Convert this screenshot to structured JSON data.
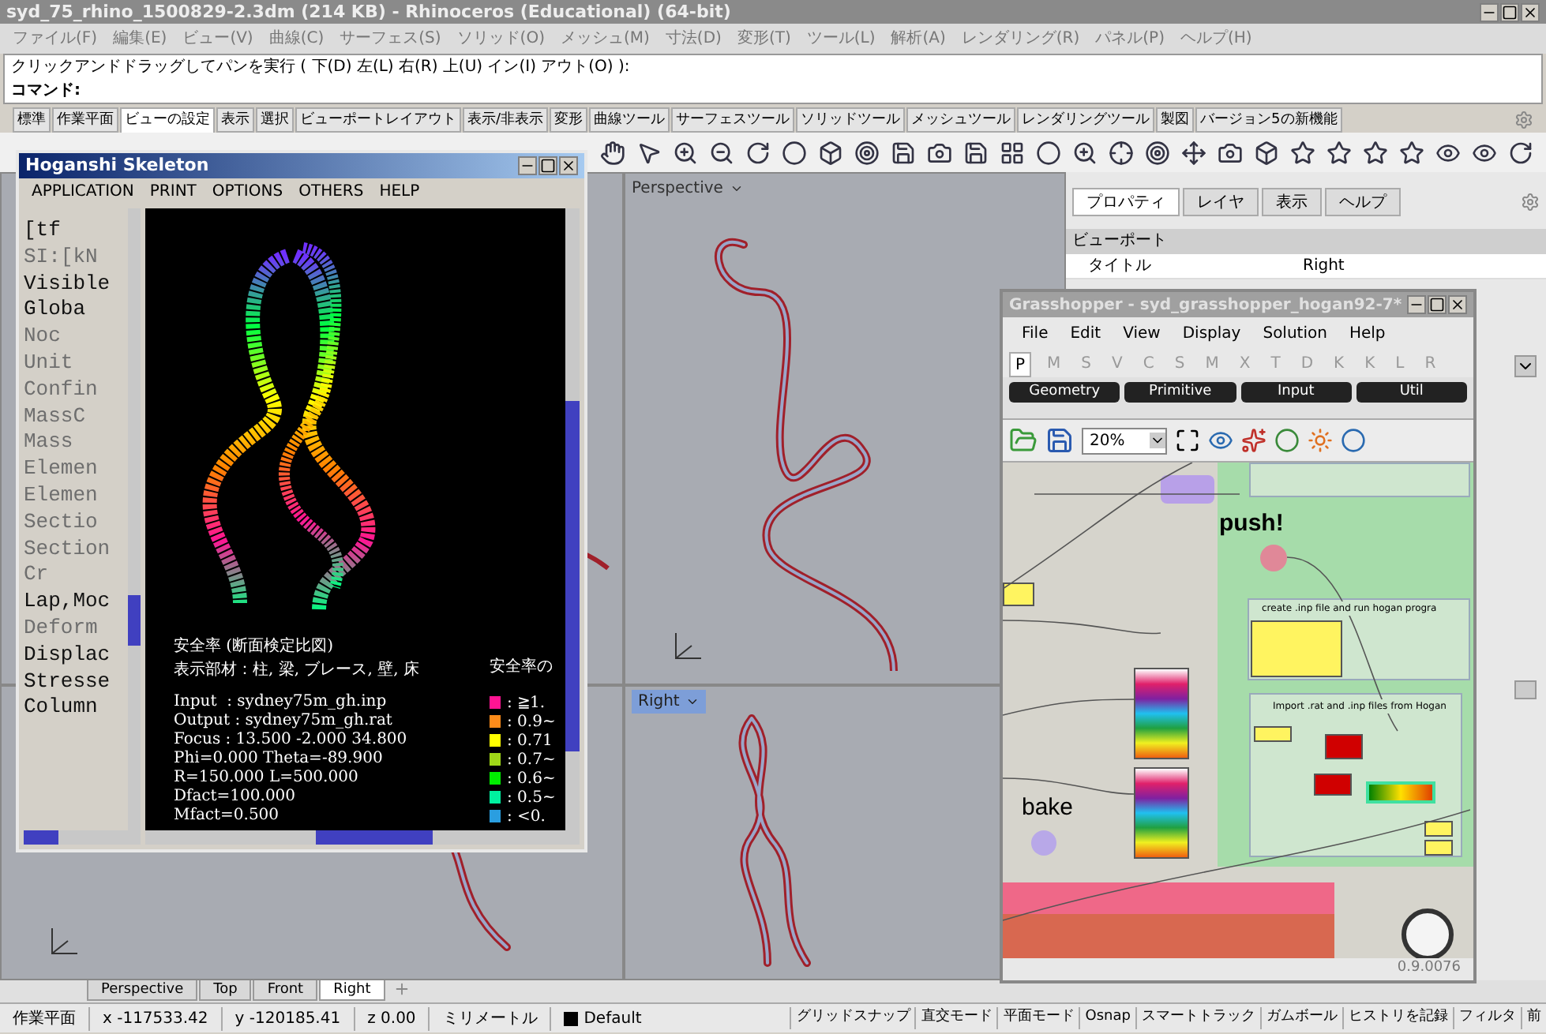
{
  "window": {
    "title": "syd_75_rhino_1500829-2.3dm (214 KB) - Rhinoceros (Educational) (64-bit)"
  },
  "menu": [
    "ファイル(F)",
    "編集(E)",
    "ビュー(V)",
    "曲線(C)",
    "サーフェス(S)",
    "ソリッド(O)",
    "メッシュ(M)",
    "寸法(D)",
    "変形(T)",
    "ツール(L)",
    "解析(A)",
    "レンダリング(R)",
    "パネル(P)",
    "ヘルプ(H)"
  ],
  "command": {
    "prompt": "クリックアンドドラッグしてパンを実行 ( 下(D) 左(L) 右(R) 上(U) イン(I) アウト(O) ):",
    "label": "コマンド:"
  },
  "toolbar_tabs": [
    {
      "label": "標準",
      "selected": false
    },
    {
      "label": "作業平面",
      "selected": false
    },
    {
      "label": "ビューの設定",
      "selected": true
    },
    {
      "label": "表示",
      "selected": false
    },
    {
      "label": "選択",
      "selected": false
    },
    {
      "label": "ビューポートレイアウト",
      "selected": false
    },
    {
      "label": "表示/非表示",
      "selected": false
    },
    {
      "label": "変形",
      "selected": false
    },
    {
      "label": "曲線ツール",
      "selected": false
    },
    {
      "label": "サーフェスツール",
      "selected": false
    },
    {
      "label": "ソリッドツール",
      "selected": false
    },
    {
      "label": "メッシュツール",
      "selected": false
    },
    {
      "label": "レンダリングツール",
      "selected": false
    },
    {
      "label": "製図",
      "selected": false
    },
    {
      "label": "バージョン5の新機能",
      "selected": false
    }
  ],
  "viewports": [
    {
      "title": "Perspective",
      "active": false
    },
    {
      "title": "Right",
      "active": true
    }
  ],
  "viewport_tabs": [
    {
      "label": "Perspective",
      "selected": false
    },
    {
      "label": "Top",
      "selected": false
    },
    {
      "label": "Front",
      "selected": false
    },
    {
      "label": "Right",
      "selected": true
    }
  ],
  "panel": {
    "tabs": [
      {
        "label": "プロパティ",
        "selected": true
      },
      {
        "label": "レイヤ",
        "selected": false
      },
      {
        "label": "表示",
        "selected": false
      },
      {
        "label": "ヘルプ",
        "selected": false
      }
    ],
    "section": "ビューポート",
    "rows": [
      {
        "label": "タイトル",
        "value": "Right"
      }
    ]
  },
  "status_bar": {
    "cells": [
      "作業平面",
      "x -117533.42",
      "y -120185.41",
      "z 0.00",
      "ミリメートル"
    ],
    "layer": "Default",
    "toggles": [
      "グリッドスナップ",
      "直交モード",
      "平面モード",
      "Osnap",
      "スマートトラック",
      "ガムボール",
      "ヒストリを記録",
      "フィルタ",
      "前"
    ]
  },
  "hoganshi": {
    "title": "Hoganshi Skeleton",
    "menu": [
      "APPLICATION",
      "PRINT",
      "OPTIONS",
      "OTHERS",
      "HELP"
    ],
    "list": [
      {
        "text": "[tf",
        "disabled": false
      },
      {
        "text": "SI:[kN",
        "disabled": true
      },
      {
        "text": "Visible",
        "disabled": false
      },
      {
        "text": "Globa",
        "disabled": false
      },
      {
        "text": "Noc",
        "disabled": true
      },
      {
        "text": "Unit",
        "disabled": true
      },
      {
        "text": "Confin",
        "disabled": true
      },
      {
        "text": "MassC",
        "disabled": true
      },
      {
        "text": "Mass",
        "disabled": true
      },
      {
        "text": "Elemen",
        "disabled": true
      },
      {
        "text": "Elemen",
        "disabled": true
      },
      {
        "text": "Sectio",
        "disabled": true
      },
      {
        "text": "Section",
        "disabled": true
      },
      {
        "text": "Cr",
        "disabled": true
      },
      {
        "text": "Lap,Moc",
        "disabled": false
      },
      {
        "text": "Deform",
        "disabled": true
      },
      {
        "text": "Displac",
        "disabled": false
      },
      {
        "text": "Stresse",
        "disabled": false
      },
      {
        "text": "Column",
        "disabled": false
      }
    ],
    "caption": [
      "安全率 (断面検定比図)",
      "表示部材：柱, 梁, ブレース, 壁, 床"
    ],
    "legend_title": "安全率の",
    "info": [
      "Input  : sydney75m_gh.inp",
      "Output : sydney75m_gh.rat",
      "Focus : 13.500 -2.000 34.800",
      "Phi=0.000 Theta=-89.900",
      "R=150.000 L=500.000",
      "Dfact=100.000",
      "Mfact=0.500"
    ],
    "legend": [
      {
        "label": ": ≧1.",
        "color": "#ff1493"
      },
      {
        "label": ": 0.9~",
        "color": "#ff8c1a"
      },
      {
        "label": ": 0.71",
        "color": "#ffff00"
      },
      {
        "label": ": 0.7~",
        "color": "#a0d818"
      },
      {
        "label": ": 0.6~",
        "color": "#00ee00"
      },
      {
        "label": ": 0.5~",
        "color": "#00f0a0"
      },
      {
        "label": ": <0.",
        "color": "#2a9ee0"
      }
    ]
  },
  "grasshopper": {
    "title": "Grasshopper - syd_grasshopper_hogan92-7*",
    "menu": [
      "File",
      "Edit",
      "View",
      "Display",
      "Solution",
      "Help"
    ],
    "tabs": [
      {
        "label": "P",
        "selected": true
      },
      {
        "label": "M",
        "selected": false
      },
      {
        "label": "S",
        "selected": false
      },
      {
        "label": "V",
        "selected": false
      },
      {
        "label": "C",
        "selected": false
      },
      {
        "label": "S",
        "selected": false
      },
      {
        "label": "M",
        "selected": false
      },
      {
        "label": "X",
        "selected": false
      },
      {
        "label": "T",
        "selected": false
      },
      {
        "label": "D",
        "selected": false
      },
      {
        "label": "K",
        "selected": false
      },
      {
        "label": "K",
        "selected": false
      },
      {
        "label": "L",
        "selected": false
      },
      {
        "label": "R",
        "selected": false
      }
    ],
    "categories": [
      "Geometry",
      "Primitive",
      "Input",
      "Util"
    ],
    "zoom": "20%",
    "push_label": "push!",
    "bake_label": "bake",
    "groups": [
      "create .inp file and run hogan progra",
      "Import .rat and .inp files from Hogan"
    ],
    "version": "0.9.0076"
  }
}
